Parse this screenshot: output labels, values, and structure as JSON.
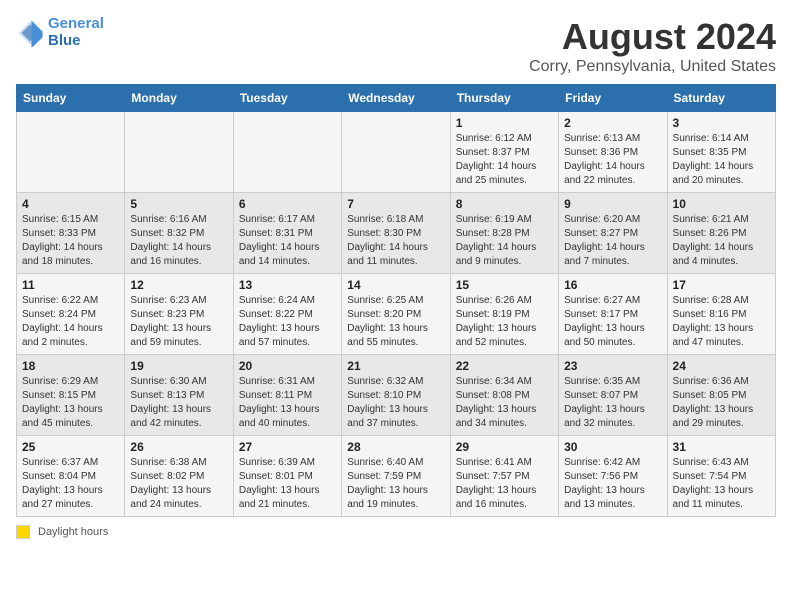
{
  "header": {
    "logo_line1": "General",
    "logo_line2": "Blue",
    "title": "August 2024",
    "subtitle": "Corry, Pennsylvania, United States"
  },
  "weekdays": [
    "Sunday",
    "Monday",
    "Tuesday",
    "Wednesday",
    "Thursday",
    "Friday",
    "Saturday"
  ],
  "weeks": [
    [
      {
        "day": "",
        "info": ""
      },
      {
        "day": "",
        "info": ""
      },
      {
        "day": "",
        "info": ""
      },
      {
        "day": "",
        "info": ""
      },
      {
        "day": "1",
        "info": "Sunrise: 6:12 AM\nSunset: 8:37 PM\nDaylight: 14 hours\nand 25 minutes."
      },
      {
        "day": "2",
        "info": "Sunrise: 6:13 AM\nSunset: 8:36 PM\nDaylight: 14 hours\nand 22 minutes."
      },
      {
        "day": "3",
        "info": "Sunrise: 6:14 AM\nSunset: 8:35 PM\nDaylight: 14 hours\nand 20 minutes."
      }
    ],
    [
      {
        "day": "4",
        "info": "Sunrise: 6:15 AM\nSunset: 8:33 PM\nDaylight: 14 hours\nand 18 minutes."
      },
      {
        "day": "5",
        "info": "Sunrise: 6:16 AM\nSunset: 8:32 PM\nDaylight: 14 hours\nand 16 minutes."
      },
      {
        "day": "6",
        "info": "Sunrise: 6:17 AM\nSunset: 8:31 PM\nDaylight: 14 hours\nand 14 minutes."
      },
      {
        "day": "7",
        "info": "Sunrise: 6:18 AM\nSunset: 8:30 PM\nDaylight: 14 hours\nand 11 minutes."
      },
      {
        "day": "8",
        "info": "Sunrise: 6:19 AM\nSunset: 8:28 PM\nDaylight: 14 hours\nand 9 minutes."
      },
      {
        "day": "9",
        "info": "Sunrise: 6:20 AM\nSunset: 8:27 PM\nDaylight: 14 hours\nand 7 minutes."
      },
      {
        "day": "10",
        "info": "Sunrise: 6:21 AM\nSunset: 8:26 PM\nDaylight: 14 hours\nand 4 minutes."
      }
    ],
    [
      {
        "day": "11",
        "info": "Sunrise: 6:22 AM\nSunset: 8:24 PM\nDaylight: 14 hours\nand 2 minutes."
      },
      {
        "day": "12",
        "info": "Sunrise: 6:23 AM\nSunset: 8:23 PM\nDaylight: 13 hours\nand 59 minutes."
      },
      {
        "day": "13",
        "info": "Sunrise: 6:24 AM\nSunset: 8:22 PM\nDaylight: 13 hours\nand 57 minutes."
      },
      {
        "day": "14",
        "info": "Sunrise: 6:25 AM\nSunset: 8:20 PM\nDaylight: 13 hours\nand 55 minutes."
      },
      {
        "day": "15",
        "info": "Sunrise: 6:26 AM\nSunset: 8:19 PM\nDaylight: 13 hours\nand 52 minutes."
      },
      {
        "day": "16",
        "info": "Sunrise: 6:27 AM\nSunset: 8:17 PM\nDaylight: 13 hours\nand 50 minutes."
      },
      {
        "day": "17",
        "info": "Sunrise: 6:28 AM\nSunset: 8:16 PM\nDaylight: 13 hours\nand 47 minutes."
      }
    ],
    [
      {
        "day": "18",
        "info": "Sunrise: 6:29 AM\nSunset: 8:15 PM\nDaylight: 13 hours\nand 45 minutes."
      },
      {
        "day": "19",
        "info": "Sunrise: 6:30 AM\nSunset: 8:13 PM\nDaylight: 13 hours\nand 42 minutes."
      },
      {
        "day": "20",
        "info": "Sunrise: 6:31 AM\nSunset: 8:11 PM\nDaylight: 13 hours\nand 40 minutes."
      },
      {
        "day": "21",
        "info": "Sunrise: 6:32 AM\nSunset: 8:10 PM\nDaylight: 13 hours\nand 37 minutes."
      },
      {
        "day": "22",
        "info": "Sunrise: 6:34 AM\nSunset: 8:08 PM\nDaylight: 13 hours\nand 34 minutes."
      },
      {
        "day": "23",
        "info": "Sunrise: 6:35 AM\nSunset: 8:07 PM\nDaylight: 13 hours\nand 32 minutes."
      },
      {
        "day": "24",
        "info": "Sunrise: 6:36 AM\nSunset: 8:05 PM\nDaylight: 13 hours\nand 29 minutes."
      }
    ],
    [
      {
        "day": "25",
        "info": "Sunrise: 6:37 AM\nSunset: 8:04 PM\nDaylight: 13 hours\nand 27 minutes."
      },
      {
        "day": "26",
        "info": "Sunrise: 6:38 AM\nSunset: 8:02 PM\nDaylight: 13 hours\nand 24 minutes."
      },
      {
        "day": "27",
        "info": "Sunrise: 6:39 AM\nSunset: 8:01 PM\nDaylight: 13 hours\nand 21 minutes."
      },
      {
        "day": "28",
        "info": "Sunrise: 6:40 AM\nSunset: 7:59 PM\nDaylight: 13 hours\nand 19 minutes."
      },
      {
        "day": "29",
        "info": "Sunrise: 6:41 AM\nSunset: 7:57 PM\nDaylight: 13 hours\nand 16 minutes."
      },
      {
        "day": "30",
        "info": "Sunrise: 6:42 AM\nSunset: 7:56 PM\nDaylight: 13 hours\nand 13 minutes."
      },
      {
        "day": "31",
        "info": "Sunrise: 6:43 AM\nSunset: 7:54 PM\nDaylight: 13 hours\nand 11 minutes."
      }
    ]
  ],
  "legend": {
    "box_label": "Daylight hours"
  }
}
